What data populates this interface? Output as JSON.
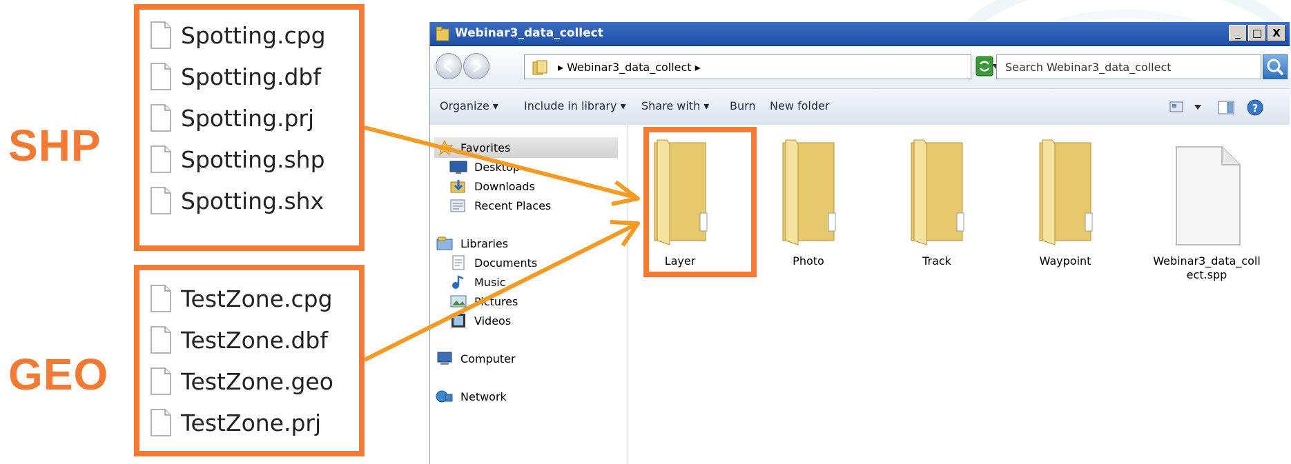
{
  "annotation": {
    "shp_label": "SHP",
    "geo_label": "GEO",
    "shp_files": [
      "Spotting.cpg",
      "Spotting.dbf",
      "Spotting.prj",
      "Spotting.shp",
      "Spotting.shx"
    ],
    "geo_files": [
      "TestZone.cpg",
      "TestZone.dbf",
      "TestZone.geo",
      "TestZone.prj"
    ],
    "accent_color": "#f47a34"
  },
  "window": {
    "title": "Webinar3_data_collect",
    "controls": [
      "_",
      "□",
      "X"
    ]
  },
  "address": {
    "path": "▸ Webinar3_data_collect ▸",
    "search_placeholder": "Search Webinar3_data_collect"
  },
  "toolbar": {
    "organize": "Organize ▾",
    "include": "Include in library ▾",
    "share": "Share with ▾",
    "burn": "Burn",
    "new_folder": "New folder"
  },
  "nav": {
    "favorites": "Favorites",
    "desktop": "Desktop",
    "downloads": "Downloads",
    "recent": "Recent Places",
    "libraries": "Libraries",
    "documents": "Documents",
    "music": "Music",
    "pictures": "Pictures",
    "videos": "Videos",
    "computer": "Computer",
    "network": "Network"
  },
  "items": [
    {
      "name": "Layer",
      "type": "folder"
    },
    {
      "name": "Photo",
      "type": "folder"
    },
    {
      "name": "Track",
      "type": "folder"
    },
    {
      "name": "Waypoint",
      "type": "folder"
    },
    {
      "name": "Webinar3_data_coll ect.spp",
      "type": "file"
    }
  ]
}
